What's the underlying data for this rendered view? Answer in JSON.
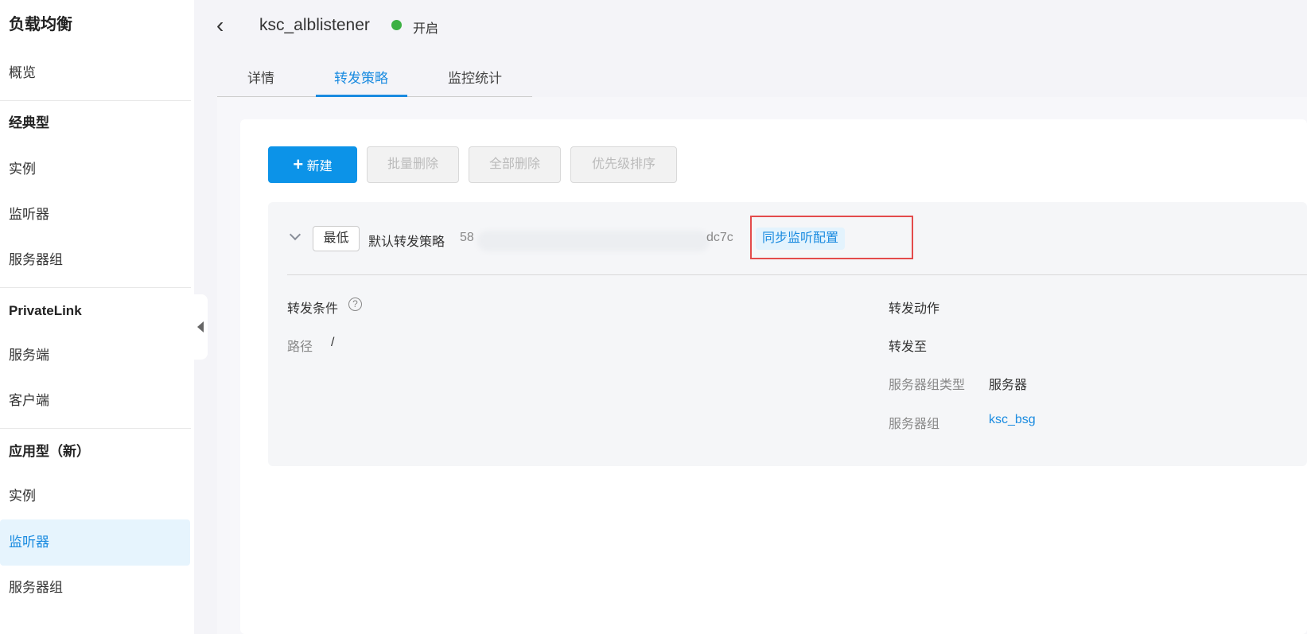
{
  "sidebar": {
    "title": "负载均衡",
    "items": [
      {
        "label": "概览"
      },
      {
        "label": "经典型"
      },
      {
        "label": "实例"
      },
      {
        "label": "监听器"
      },
      {
        "label": "服务器组"
      },
      {
        "label": "PrivateLink"
      },
      {
        "label": "服务端"
      },
      {
        "label": "客户端"
      },
      {
        "label": "应用型（新）"
      },
      {
        "label": "实例"
      },
      {
        "label": "监听器"
      },
      {
        "label": "服务器组"
      }
    ]
  },
  "header": {
    "back": "‹",
    "title": "ksc_alblistener",
    "status": "开启",
    "status_color": "#3cb043"
  },
  "tabs": [
    {
      "label": "详情"
    },
    {
      "label": "转发策略"
    },
    {
      "label": "监控统计"
    }
  ],
  "toolbar": {
    "new": "新建",
    "batch_delete": "批量删除",
    "delete_all": "全部删除",
    "priority_sort": "优先级排序"
  },
  "rule": {
    "priority": "最低",
    "name": "默认转发策略",
    "id_start": "58",
    "id_end": "dc7c",
    "sync": "同步监听配置",
    "conditions_label": "转发条件",
    "help": "?",
    "path_label": "路径",
    "path_value": "/",
    "action_label": "转发动作",
    "forward_to": "转发至",
    "bsg_type_label": "服务器组类型",
    "bsg_type_value": "服务器",
    "bsg_label": "服务器组",
    "bsg_value": "ksc_bsg"
  }
}
